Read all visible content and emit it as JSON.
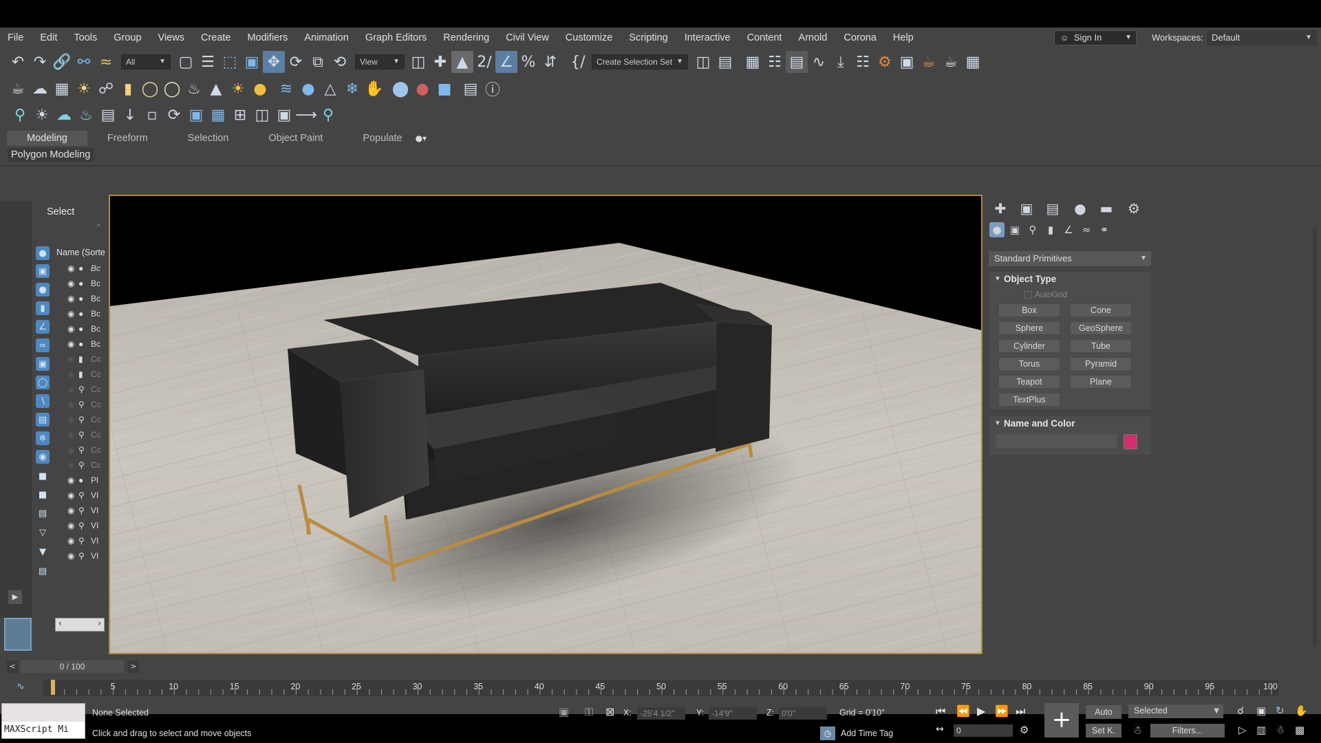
{
  "menu": [
    "File",
    "Edit",
    "Tools",
    "Group",
    "Views",
    "Create",
    "Modifiers",
    "Animation",
    "Graph Editors",
    "Rendering",
    "Civil View",
    "Customize",
    "Scripting",
    "Interactive",
    "Content",
    "Arnold",
    "Corona",
    "Help"
  ],
  "account": {
    "sign_in": "Sign In",
    "workspaces_label": "Workspaces:",
    "workspace_value": "Default"
  },
  "toolbar": {
    "filter_value": "All",
    "ref_coord": "View",
    "selection_set": "Create Selection Set"
  },
  "ribbon": {
    "tabs": [
      "Modeling",
      "Freeform",
      "Selection",
      "Object Paint",
      "Populate"
    ],
    "active_tab": "Modeling",
    "panel_label": "Polygon Modeling"
  },
  "explorer": {
    "select_label": "Select",
    "column_header": "Name (Sorte",
    "rows": [
      "Bc",
      "Bc",
      "Bc",
      "Bc",
      "Bc",
      "Bc",
      "Cc",
      "Cc",
      "Cc",
      "Cc",
      "Cc",
      "Cc",
      "Cc",
      "Cc",
      "Pl",
      "VI",
      "VI",
      "VI",
      "VI",
      "VI"
    ]
  },
  "command_panel": {
    "category": "Standard Primitives",
    "object_type_title": "Object Type",
    "autogrid": "AutoGrid",
    "buttons": [
      "Box",
      "Cone",
      "Sphere",
      "GeoSphere",
      "Cylinder",
      "Tube",
      "Torus",
      "Pyramid",
      "Teapot",
      "Plane",
      "TextPlus"
    ],
    "name_color_title": "Name and Color",
    "object_color": "#d12e6e"
  },
  "timeline": {
    "frame_display": "0 / 100",
    "ticks": [
      "5",
      "10",
      "15",
      "20",
      "25",
      "30",
      "35",
      "40",
      "45",
      "50",
      "55",
      "60",
      "65",
      "70",
      "75",
      "80",
      "85",
      "90",
      "95",
      "100"
    ]
  },
  "status": {
    "maxscript": "MAXScript Mi",
    "selection": "None Selected",
    "prompt": "Click and drag to select and move objects",
    "x_label": "X:",
    "x_value": "-25'4 1/2\"",
    "y_label": "Y:",
    "y_value": "-14'9\"",
    "z_label": "Z:",
    "z_value": "0'0\"",
    "grid": "Grid = 0'10\"",
    "add_time_tag": "Add Time Tag",
    "auto_key": "Auto",
    "set_key": "Set K.",
    "key_filter": "Selected",
    "filters": "Filters...",
    "frame_value": "0"
  }
}
